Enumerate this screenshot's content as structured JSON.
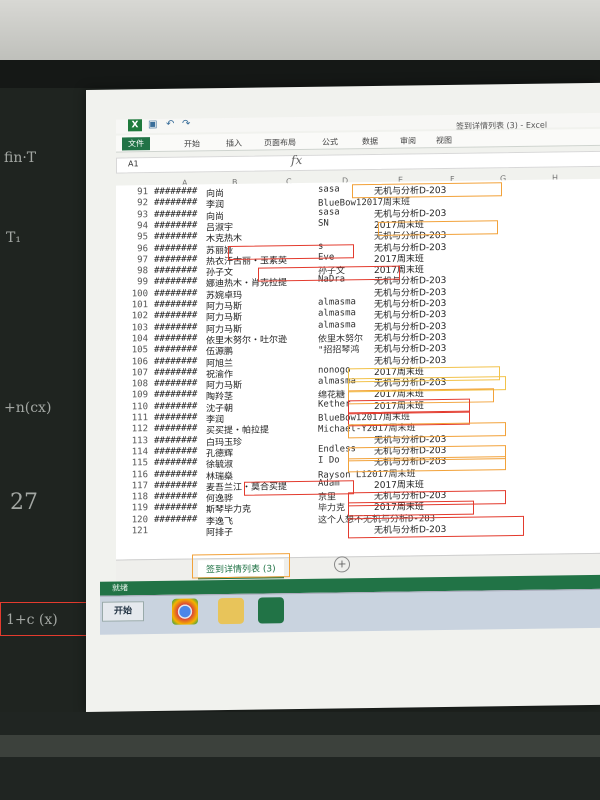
{
  "window": {
    "title": "签到详情列表 (3) - Excel"
  },
  "ribbon_tabs": [
    "文件",
    "开始",
    "插入",
    "页面布局",
    "公式",
    "数据",
    "审阅",
    "视图"
  ],
  "formula_bar": {
    "name_box": "A1",
    "fx": "fx"
  },
  "column_headers": [
    "A",
    "B",
    "C",
    "D",
    "E",
    "F",
    "G",
    "H"
  ],
  "rows": [
    {
      "n": "91",
      "a": "########",
      "b": "向尚",
      "d": "sasa",
      "e": "无机与分析D-203"
    },
    {
      "n": "92",
      "a": "########",
      "b": "李润",
      "d": "BlueBow12017周末班",
      "e": ""
    },
    {
      "n": "93",
      "a": "########",
      "b": "向尚",
      "d": "sasa",
      "e": "无机与分析D-203"
    },
    {
      "n": "94",
      "a": "########",
      "b": "吕淑宇",
      "d": "SN",
      "e": "2017周末班"
    },
    {
      "n": "95",
      "a": "########",
      "b": "木克热木",
      "d": "",
      "e": "无机与分析D-203"
    },
    {
      "n": "96",
      "a": "########",
      "b": "苏丽娅",
      "d": "s",
      "e": "无机与分析D-203"
    },
    {
      "n": "97",
      "a": "########",
      "b": "热衣汗古丽・玉素英",
      "d": "Eve",
      "e": "2017周末班"
    },
    {
      "n": "98",
      "a": "########",
      "b": "孙子文",
      "d": "孙子文",
      "e": "2017周末班"
    },
    {
      "n": "99",
      "a": "########",
      "b": "娜迪热木・肖克拉提",
      "d": "NaDra",
      "e": "无机与分析D-203"
    },
    {
      "n": "100",
      "a": "########",
      "b": "苏婉卓玛",
      "d": "",
      "e": "无机与分析D-203"
    },
    {
      "n": "101",
      "a": "########",
      "b": "阿力马斯",
      "d": "almasma",
      "e": "无机与分析D-203"
    },
    {
      "n": "102",
      "a": "########",
      "b": "阿力马斯",
      "d": "almasma",
      "e": "无机与分析D-203"
    },
    {
      "n": "103",
      "a": "########",
      "b": "阿力马斯",
      "d": "almasma",
      "e": "无机与分析D-203"
    },
    {
      "n": "104",
      "a": "########",
      "b": "依里木努尔・吐尔逊",
      "d": "依里木努尔",
      "e": "无机与分析D-203"
    },
    {
      "n": "105",
      "a": "########",
      "b": "伍源鹏",
      "d": "\"招招琴鸿",
      "e": "无机与分析D-203"
    },
    {
      "n": "106",
      "a": "########",
      "b": "阿旭兰",
      "d": "",
      "e": "无机与分析D-203"
    },
    {
      "n": "107",
      "a": "########",
      "b": "祝渝作",
      "d": "nonogo",
      "e": "2017周末班"
    },
    {
      "n": "108",
      "a": "########",
      "b": "阿力马斯",
      "d": "almasma",
      "e": "无机与分析D-203"
    },
    {
      "n": "109",
      "a": "########",
      "b": "陶羚茎",
      "d": "绵花糖",
      "e": "2017周末班"
    },
    {
      "n": "110",
      "a": "########",
      "b": "沈子朝",
      "d": "Kether",
      "e": "2017周末班"
    },
    {
      "n": "111",
      "a": "########",
      "b": "李润",
      "d": "BlueBow12017周末班",
      "e": ""
    },
    {
      "n": "112",
      "a": "########",
      "b": "买买提・帕拉提",
      "d": "Michael-Y2017周末班",
      "e": ""
    },
    {
      "n": "113",
      "a": "########",
      "b": "白玛玉珍",
      "d": "",
      "e": "无机与分析D-203"
    },
    {
      "n": "114",
      "a": "########",
      "b": "孔德辉",
      "d": "Endless",
      "e": "无机与分析D-203"
    },
    {
      "n": "115",
      "a": "########",
      "b": "徐毓淑",
      "d": "I Do",
      "e": "无机与分析D-203"
    },
    {
      "n": "116",
      "a": "########",
      "b": "林瑞燊",
      "d": "Rayson Li2017周末班",
      "e": ""
    },
    {
      "n": "117",
      "a": "########",
      "b": "麦吾兰江・莫合买提",
      "d": "Adam",
      "e": "2017周末班"
    },
    {
      "n": "118",
      "a": "########",
      "b": "何逸骅",
      "d": "京里",
      "e": "无机与分析D-203"
    },
    {
      "n": "119",
      "a": "########",
      "b": "斯琴毕力克",
      "d": "毕力克",
      "e": "2017周末班"
    },
    {
      "n": "120",
      "a": "########",
      "b": "李逸飞",
      "d": "这个人想不无机与分析D-203",
      "e": ""
    },
    {
      "n": "121",
      "a": "",
      "b": "阿排子",
      "d": "",
      "e": "无机与分析D-203"
    }
  ],
  "sheet_tab": "签到详情列表 (3)",
  "add_sheet": "+",
  "status_text": "就绪",
  "taskbar": {
    "start_label": "开始"
  },
  "chalk_board": {
    "note": "1+c (x)"
  }
}
